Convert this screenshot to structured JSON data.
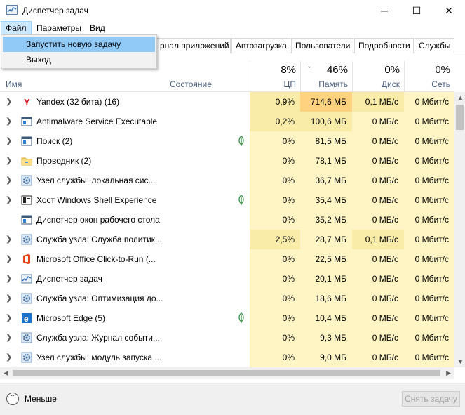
{
  "window": {
    "title": "Диспетчер задач",
    "minimize_glyph": "─",
    "maximize_glyph": "☐",
    "close_glyph": "✕"
  },
  "menu": {
    "items": [
      "Файл",
      "Параметры",
      "Вид"
    ],
    "active_item": "Файл",
    "file_dropdown": [
      "Запустить новую задачу",
      "Выход"
    ],
    "highlighted_dropdown_item": "Запустить новую задачу"
  },
  "tabs": [
    "рнал приложений",
    "Автозагрузка",
    "Пользователи",
    "Подробности",
    "Службы"
  ],
  "columns": {
    "name": "Имя",
    "state": "Состояние",
    "cpu": {
      "label": "ЦП",
      "percent": "8%"
    },
    "memory": {
      "label": "Память",
      "percent": "46%",
      "sorted": true
    },
    "disk": {
      "label": "Диск",
      "percent": "0%"
    },
    "network": {
      "label": "Сеть",
      "percent": "0%"
    }
  },
  "heat_colors": {
    "none": "#ffffff",
    "light": "#fff4c4",
    "medium": "#f9eca8",
    "strong": "#ffd280"
  },
  "processes": [
    {
      "name": "Yandex (32 бита) (16)",
      "icon": "yandex-icon",
      "expandable": true,
      "leaf": false,
      "cpu": "0,9%",
      "memory": "714,6 МБ",
      "disk": "0,1 МБ/с",
      "network": "0 Мбит/с",
      "cpu_heat": "medium",
      "memory_heat": "strong",
      "disk_heat": "medium",
      "network_heat": "light"
    },
    {
      "name": "Antimalware Service Executable",
      "icon": "window-app-icon",
      "expandable": true,
      "leaf": false,
      "cpu": "0,2%",
      "memory": "100,6 МБ",
      "disk": "0 МБ/с",
      "network": "0 Мбит/с",
      "cpu_heat": "medium",
      "memory_heat": "medium",
      "disk_heat": "light",
      "network_heat": "light"
    },
    {
      "name": "Поиск (2)",
      "icon": "window-app-icon",
      "expandable": true,
      "leaf": true,
      "cpu": "0%",
      "memory": "81,5 МБ",
      "disk": "0 МБ/с",
      "network": "0 Мбит/с",
      "cpu_heat": "light",
      "memory_heat": "light",
      "disk_heat": "light",
      "network_heat": "light"
    },
    {
      "name": "Проводник (2)",
      "icon": "folder-icon",
      "expandable": true,
      "leaf": false,
      "cpu": "0%",
      "memory": "78,1 МБ",
      "disk": "0 МБ/с",
      "network": "0 Мбит/с",
      "cpu_heat": "light",
      "memory_heat": "light",
      "disk_heat": "light",
      "network_heat": "light"
    },
    {
      "name": "Узел службы: локальная сис...",
      "icon": "gear-icon",
      "expandable": true,
      "leaf": false,
      "cpu": "0%",
      "memory": "36,7 МБ",
      "disk": "0 МБ/с",
      "network": "0 Мбит/с",
      "cpu_heat": "light",
      "memory_heat": "light",
      "disk_heat": "light",
      "network_heat": "light"
    },
    {
      "name": "Хост Windows Shell Experience",
      "icon": "shell-host-icon",
      "expandable": true,
      "leaf": true,
      "cpu": "0%",
      "memory": "35,4 МБ",
      "disk": "0 МБ/с",
      "network": "0 Мбит/с",
      "cpu_heat": "light",
      "memory_heat": "light",
      "disk_heat": "light",
      "network_heat": "light"
    },
    {
      "name": "Диспетчер окон рабочего стола",
      "icon": "window-app-icon",
      "expandable": false,
      "leaf": false,
      "cpu": "0%",
      "memory": "35,2 МБ",
      "disk": "0 МБ/с",
      "network": "0 Мбит/с",
      "cpu_heat": "light",
      "memory_heat": "light",
      "disk_heat": "light",
      "network_heat": "light"
    },
    {
      "name": "Служба узла: Служба политик...",
      "icon": "gear-icon",
      "expandable": true,
      "leaf": false,
      "cpu": "2,5%",
      "memory": "28,7 МБ",
      "disk": "0,1 МБ/с",
      "network": "0 Мбит/с",
      "cpu_heat": "medium",
      "memory_heat": "light",
      "disk_heat": "medium",
      "network_heat": "light"
    },
    {
      "name": "Microsoft Office Click-to-Run (...",
      "icon": "office-icon",
      "expandable": true,
      "leaf": false,
      "cpu": "0%",
      "memory": "22,5 МБ",
      "disk": "0 МБ/с",
      "network": "0 Мбит/с",
      "cpu_heat": "light",
      "memory_heat": "light",
      "disk_heat": "light",
      "network_heat": "light"
    },
    {
      "name": "Диспетчер задач",
      "icon": "task-manager-icon",
      "expandable": true,
      "leaf": false,
      "cpu": "0%",
      "memory": "20,1 МБ",
      "disk": "0 МБ/с",
      "network": "0 Мбит/с",
      "cpu_heat": "light",
      "memory_heat": "light",
      "disk_heat": "light",
      "network_heat": "light"
    },
    {
      "name": "Служба узла: Оптимизация до...",
      "icon": "gear-icon",
      "expandable": true,
      "leaf": false,
      "cpu": "0%",
      "memory": "18,6 МБ",
      "disk": "0 МБ/с",
      "network": "0 Мбит/с",
      "cpu_heat": "light",
      "memory_heat": "light",
      "disk_heat": "light",
      "network_heat": "light"
    },
    {
      "name": "Microsoft Edge (5)",
      "icon": "edge-icon",
      "expandable": true,
      "leaf": true,
      "cpu": "0%",
      "memory": "10,4 МБ",
      "disk": "0 МБ/с",
      "network": "0 Мбит/с",
      "cpu_heat": "light",
      "memory_heat": "light",
      "disk_heat": "light",
      "network_heat": "light"
    },
    {
      "name": "Служба узла: Журнал событи...",
      "icon": "gear-icon",
      "expandable": true,
      "leaf": false,
      "cpu": "0%",
      "memory": "9,3 МБ",
      "disk": "0 МБ/с",
      "network": "0 Мбит/с",
      "cpu_heat": "light",
      "memory_heat": "light",
      "disk_heat": "light",
      "network_heat": "light"
    },
    {
      "name": "Узел службы: модуль запуска ...",
      "icon": "gear-icon",
      "expandable": true,
      "leaf": false,
      "cpu": "0%",
      "memory": "9,0 МБ",
      "disk": "0 МБ/с",
      "network": "0 Мбит/с",
      "cpu_heat": "light",
      "memory_heat": "light",
      "disk_heat": "light",
      "network_heat": "light"
    }
  ],
  "footer": {
    "fewer_label": "Меньше",
    "end_task_label": "Снять задачу"
  }
}
